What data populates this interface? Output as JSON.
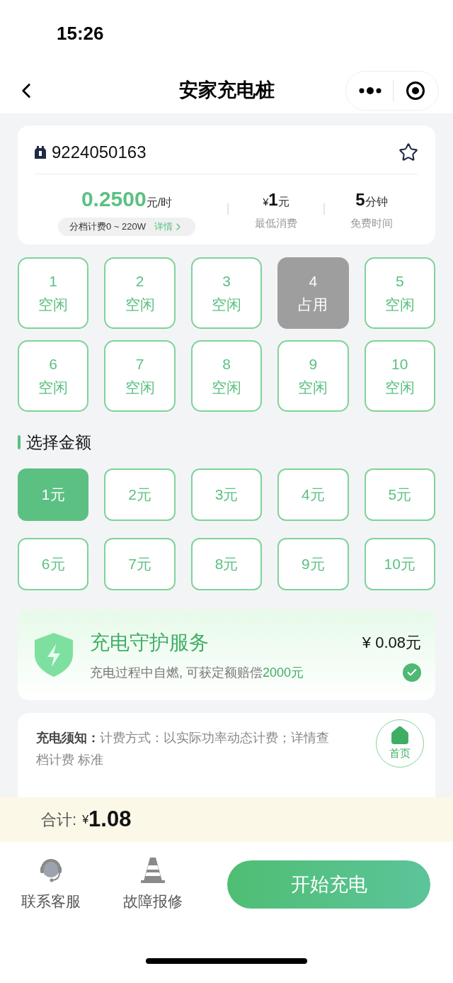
{
  "status_bar": {
    "time": "15:26"
  },
  "nav": {
    "title": "安家充电桩"
  },
  "station": {
    "id": "9224050163",
    "favorite": false,
    "price": "0.2500",
    "price_unit": "元/时",
    "tier": "分档计费0 ~ 220W",
    "tier_link": "详情",
    "min_symbol": "¥",
    "min_value": "1",
    "min_unit": "元",
    "min_label": "最低消费",
    "free_value": "5",
    "free_unit": "分钟",
    "free_label": "免费时间"
  },
  "ports": [
    {
      "number": "1",
      "status": "空闲",
      "occupied": false
    },
    {
      "number": "2",
      "status": "空闲",
      "occupied": false
    },
    {
      "number": "3",
      "status": "空闲",
      "occupied": false
    },
    {
      "number": "4",
      "status": "占用",
      "occupied": true
    },
    {
      "number": "5",
      "status": "空闲",
      "occupied": false
    },
    {
      "number": "6",
      "status": "空闲",
      "occupied": false
    },
    {
      "number": "7",
      "status": "空闲",
      "occupied": false
    },
    {
      "number": "8",
      "status": "空闲",
      "occupied": false
    },
    {
      "number": "9",
      "status": "空闲",
      "occupied": false
    },
    {
      "number": "10",
      "status": "空闲",
      "occupied": false
    }
  ],
  "amount_heading": "选择金额",
  "amounts": [
    {
      "label": "1元",
      "selected": true
    },
    {
      "label": "2元",
      "selected": false
    },
    {
      "label": "3元",
      "selected": false
    },
    {
      "label": "4元",
      "selected": false
    },
    {
      "label": "5元",
      "selected": false
    },
    {
      "label": "6元",
      "selected": false
    },
    {
      "label": "7元",
      "selected": false
    },
    {
      "label": "8元",
      "selected": false
    },
    {
      "label": "9元",
      "selected": false
    },
    {
      "label": "10元",
      "selected": false
    }
  ],
  "protection": {
    "title": "充电守护服务",
    "price": "¥ 0.08元",
    "description": "充电过程中自燃, 可获定额赔偿**2000元**",
    "checked": true
  },
  "notice": {
    "lines": [
      "**充电须知：**计费方式：以实际功率动态计费；详情查",
      "档计费 标准"
    ]
  },
  "home_button": {
    "label": "首页"
  },
  "total": {
    "label": "合计:",
    "symbol": "¥",
    "value": "1.08"
  },
  "actions": [
    {
      "kind": "support",
      "label": "联系客服"
    },
    {
      "kind": "repair",
      "label": "故障报修"
    }
  ],
  "start_button": {
    "label": "开始充电"
  }
}
